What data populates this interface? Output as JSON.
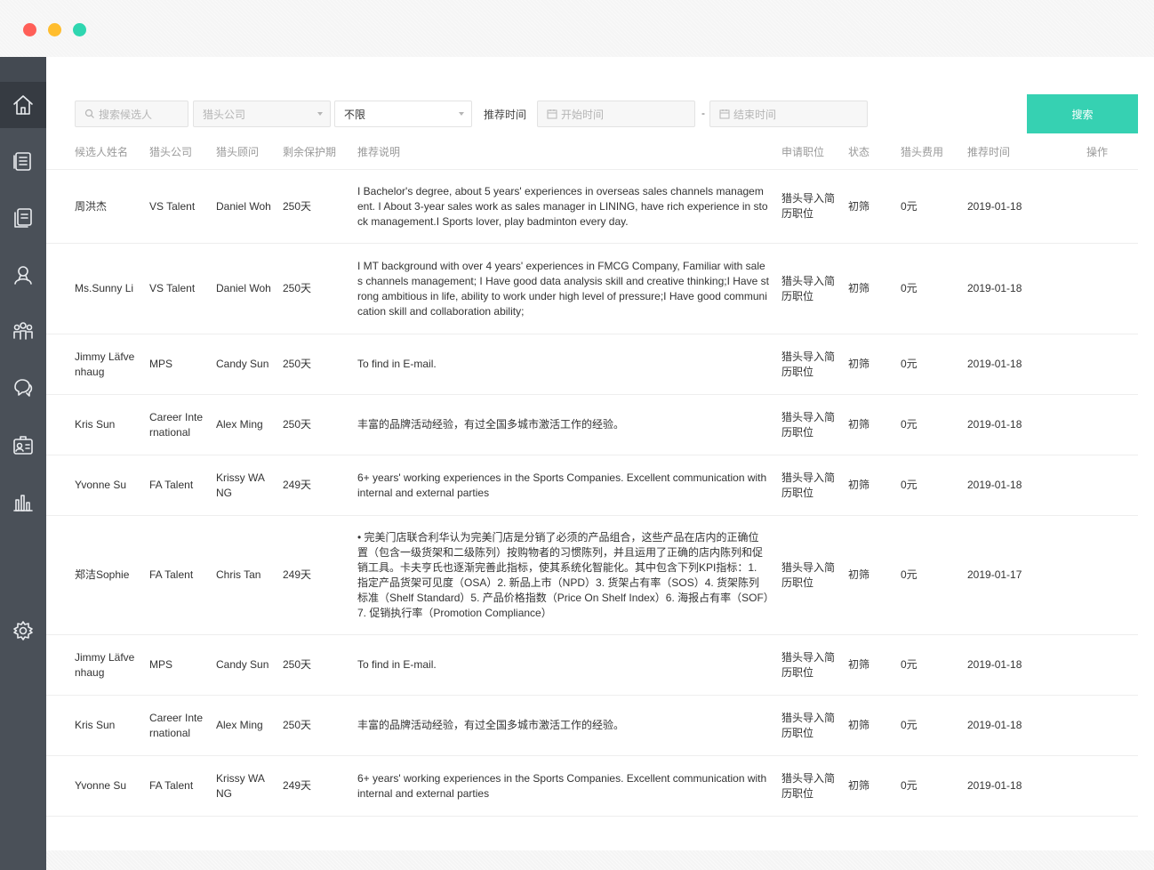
{
  "window": {
    "controls": [
      "close",
      "minimize",
      "zoom"
    ]
  },
  "sidebar": {
    "items": [
      {
        "icon": "home-icon",
        "active": true
      },
      {
        "icon": "list-icon"
      },
      {
        "icon": "document-icon"
      },
      {
        "icon": "user-icon"
      },
      {
        "icon": "team-icon"
      },
      {
        "icon": "chat-icon"
      },
      {
        "icon": "contact-card-icon"
      },
      {
        "icon": "bar-chart-icon"
      },
      {
        "icon": "gear-icon"
      }
    ]
  },
  "filters": {
    "search_placeholder": "搜索候选人",
    "company_placeholder": "猎头公司",
    "status_value": "不限",
    "time_label": "推荐时间",
    "start_placeholder": "开始时间",
    "separator": "-",
    "end_placeholder": "结束时间",
    "search_button": "搜索"
  },
  "table": {
    "headers": {
      "name": "候选人姓名",
      "company": "猎头公司",
      "consultant": "猎头顾问",
      "protection": "剩余保护期",
      "note": "推荐说明",
      "position": "申请职位",
      "status": "状态",
      "fee": "猎头费用",
      "time": "推荐时间",
      "action": "操作"
    },
    "rows": [
      {
        "name": "周洪杰",
        "company": "VS Talent",
        "consultant": "Daniel Woh",
        "protection": "250天",
        "note": "I Bachelor's degree, about 5 years' experiences in overseas sales channels management. I About 3-year sales work as sales manager in LINING, have rich experience in stock management.I Sports lover, play badminton every day.",
        "position": "猎头导入简历职位",
        "status": "初筛",
        "fee": "0元",
        "time": "2019-01-18"
      },
      {
        "name": "Ms.Sunny Li",
        "company": "VS Talent",
        "consultant": "Daniel Woh",
        "protection": "250天",
        "note": "I MT background with over 4 years' experiences in FMCG Company, Familiar with sales channels management; I Have good data analysis skill and creative thinking;I Have strong ambitious in life, ability to work under high level of pressure;I Have good communication skill and collaboration ability;",
        "position": "猎头导入简历职位",
        "status": "初筛",
        "fee": "0元",
        "time": "2019-01-18"
      },
      {
        "name": "Jimmy Läfvenhaug",
        "company": "MPS",
        "consultant": "Candy Sun",
        "protection": "250天",
        "note": "To find in E-mail.",
        "position": "猎头导入简历职位",
        "status": "初筛",
        "fee": "0元",
        "time": "2019-01-18"
      },
      {
        "name": "Kris Sun",
        "company": "Career International",
        "consultant": "Alex Ming",
        "protection": "250天",
        "note": "丰富的品牌活动经验，有过全国多城市激活工作的经验。",
        "position": "猎头导入简历职位",
        "status": "初筛",
        "fee": "0元",
        "time": "2019-01-18"
      },
      {
        "name": "Yvonne Su",
        "company": "FA Talent",
        "consultant": "Krissy WANG",
        "protection": "249天",
        "note": "6+ years' working experiences in the Sports Companies. Excellent communication with internal and external parties",
        "position": "猎头导入简历职位",
        "status": "初筛",
        "fee": "0元",
        "time": "2019-01-18"
      },
      {
        "name": "郑洁Sophie",
        "company": "FA Talent",
        "consultant": "Chris Tan",
        "protection": "249天",
        "note": "• 完美门店联合利华认为完美门店是分销了必须的产品组合，这些产品在店内的正确位置（包含一级货架和二级陈列）按购物者的习惯陈列，并且运用了正确的店内陈列和促销工具。卡夫亨氏也逐渐完善此指标，使其系统化智能化。其中包含下列KPI指标：1. 指定产品货架可见度（OSA）2. 新品上市（NPD）3. 货架占有率（SOS）4. 货架陈列标准（Shelf Standard）5. 产品价格指数（Price On Shelf Index）6. 海报占有率（SOF）7. 促销执行率（Promotion Compliance）",
        "position": "猎头导入简历职位",
        "status": "初筛",
        "fee": "0元",
        "time": "2019-01-17"
      },
      {
        "name": "Jimmy Läfvenhaug",
        "company": "MPS",
        "consultant": "Candy Sun",
        "protection": "250天",
        "note": "To find in E-mail.",
        "position": "猎头导入简历职位",
        "status": "初筛",
        "fee": "0元",
        "time": "2019-01-18"
      },
      {
        "name": "Kris Sun",
        "company": "Career International",
        "consultant": "Alex Ming",
        "protection": "250天",
        "note": "丰富的品牌活动经验，有过全国多城市激活工作的经验。",
        "position": "猎头导入简历职位",
        "status": "初筛",
        "fee": "0元",
        "time": "2019-01-18"
      },
      {
        "name": "Yvonne Su",
        "company": "FA Talent",
        "consultant": "Krissy WANG",
        "protection": "249天",
        "note": "6+ years' working experiences in the Sports Companies. Excellent communication with internal and external parties",
        "position": "猎头导入简历职位",
        "status": "初筛",
        "fee": "0元",
        "time": "2019-01-18"
      }
    ]
  },
  "colors": {
    "accent": "#36d1b2",
    "sidebar": "#4a5058",
    "sidebar_active": "#363b42"
  }
}
